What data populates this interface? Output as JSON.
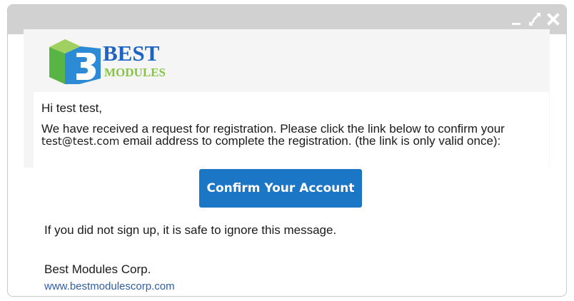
{
  "window": {
    "controls": [
      "minimize-icon",
      "expand-icon",
      "close-icon"
    ]
  },
  "logo": {
    "line1": "BEST",
    "line2": "MODULES"
  },
  "email": {
    "greeting": "Hi test test,",
    "body_part1": "We have received a request for registration. Please click the link below to confirm your ",
    "address": "test@test.com",
    "body_part2": " email address to complete the registration. (the link is only valid once):",
    "confirm_button_label": "Confirm Your Account",
    "ignore_text": "If you did not sign up, it is safe to ignore this message.",
    "company": "Best Modules Corp.",
    "website": "www.bestmodulescorp.com"
  },
  "colors": {
    "titlebar": "#d1d1d1",
    "button": "#1b76c6",
    "logo_blue": "#1d63c4",
    "logo_green": "#86c540",
    "link": "#2f5ea8"
  }
}
